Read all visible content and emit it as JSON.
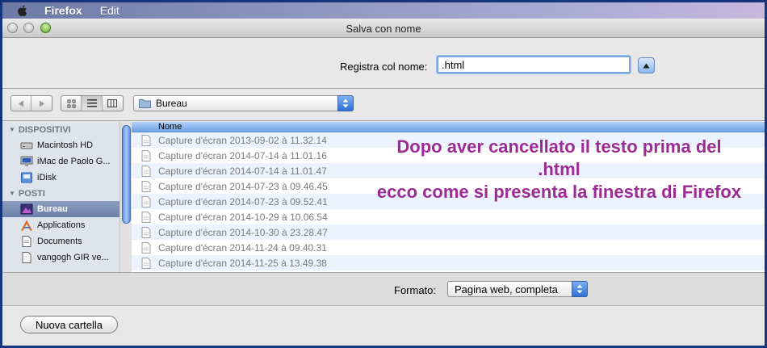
{
  "menubar": {
    "app_name": "Firefox",
    "items": [
      "Edit"
    ]
  },
  "window": {
    "title": "Salva con nome"
  },
  "save_as": {
    "label": "Registra col nome:",
    "value": ".html"
  },
  "toolbar": {
    "location": "Bureau"
  },
  "sidebar": {
    "sections": [
      {
        "title": "DISPOSITIVI",
        "items": [
          "Macintosh HD",
          "iMac de Paolo G...",
          "iDisk"
        ]
      },
      {
        "title": "POSTI",
        "items": [
          "Bureau",
          "Applications",
          "Documents",
          "vangogh GIR ve..."
        ]
      }
    ],
    "selected": "Bureau"
  },
  "filelist": {
    "column": "Nome",
    "rows": [
      "Capture d'écran 2013-09-02 à 11.32.14",
      "Capture d'écran 2014-07-14 à 11.01.16",
      "Capture d'écran 2014-07-14 à 11.01.47",
      "Capture d'écran 2014-07-23 à 09.46.45",
      "Capture d'écran 2014-07-23 à 09.52.41",
      "Capture d'écran 2014-10-29 à 10.06.54",
      "Capture d'écran 2014-10-30 à 23.28.47",
      "Capture d'écran 2014-11-24 à 09.40.31",
      "Capture d'écran 2014-11-25 à 13.49.38"
    ]
  },
  "annotation": {
    "lines": [
      "Dopo aver cancellato il testo prima del",
      ".html",
      "ecco come si presenta la finestra di Firefox"
    ],
    "color": "#9c2c93"
  },
  "format": {
    "label": "Formato:",
    "value": "Pagina web, completa"
  },
  "footer": {
    "new_folder_label": "Nuova cartella"
  }
}
